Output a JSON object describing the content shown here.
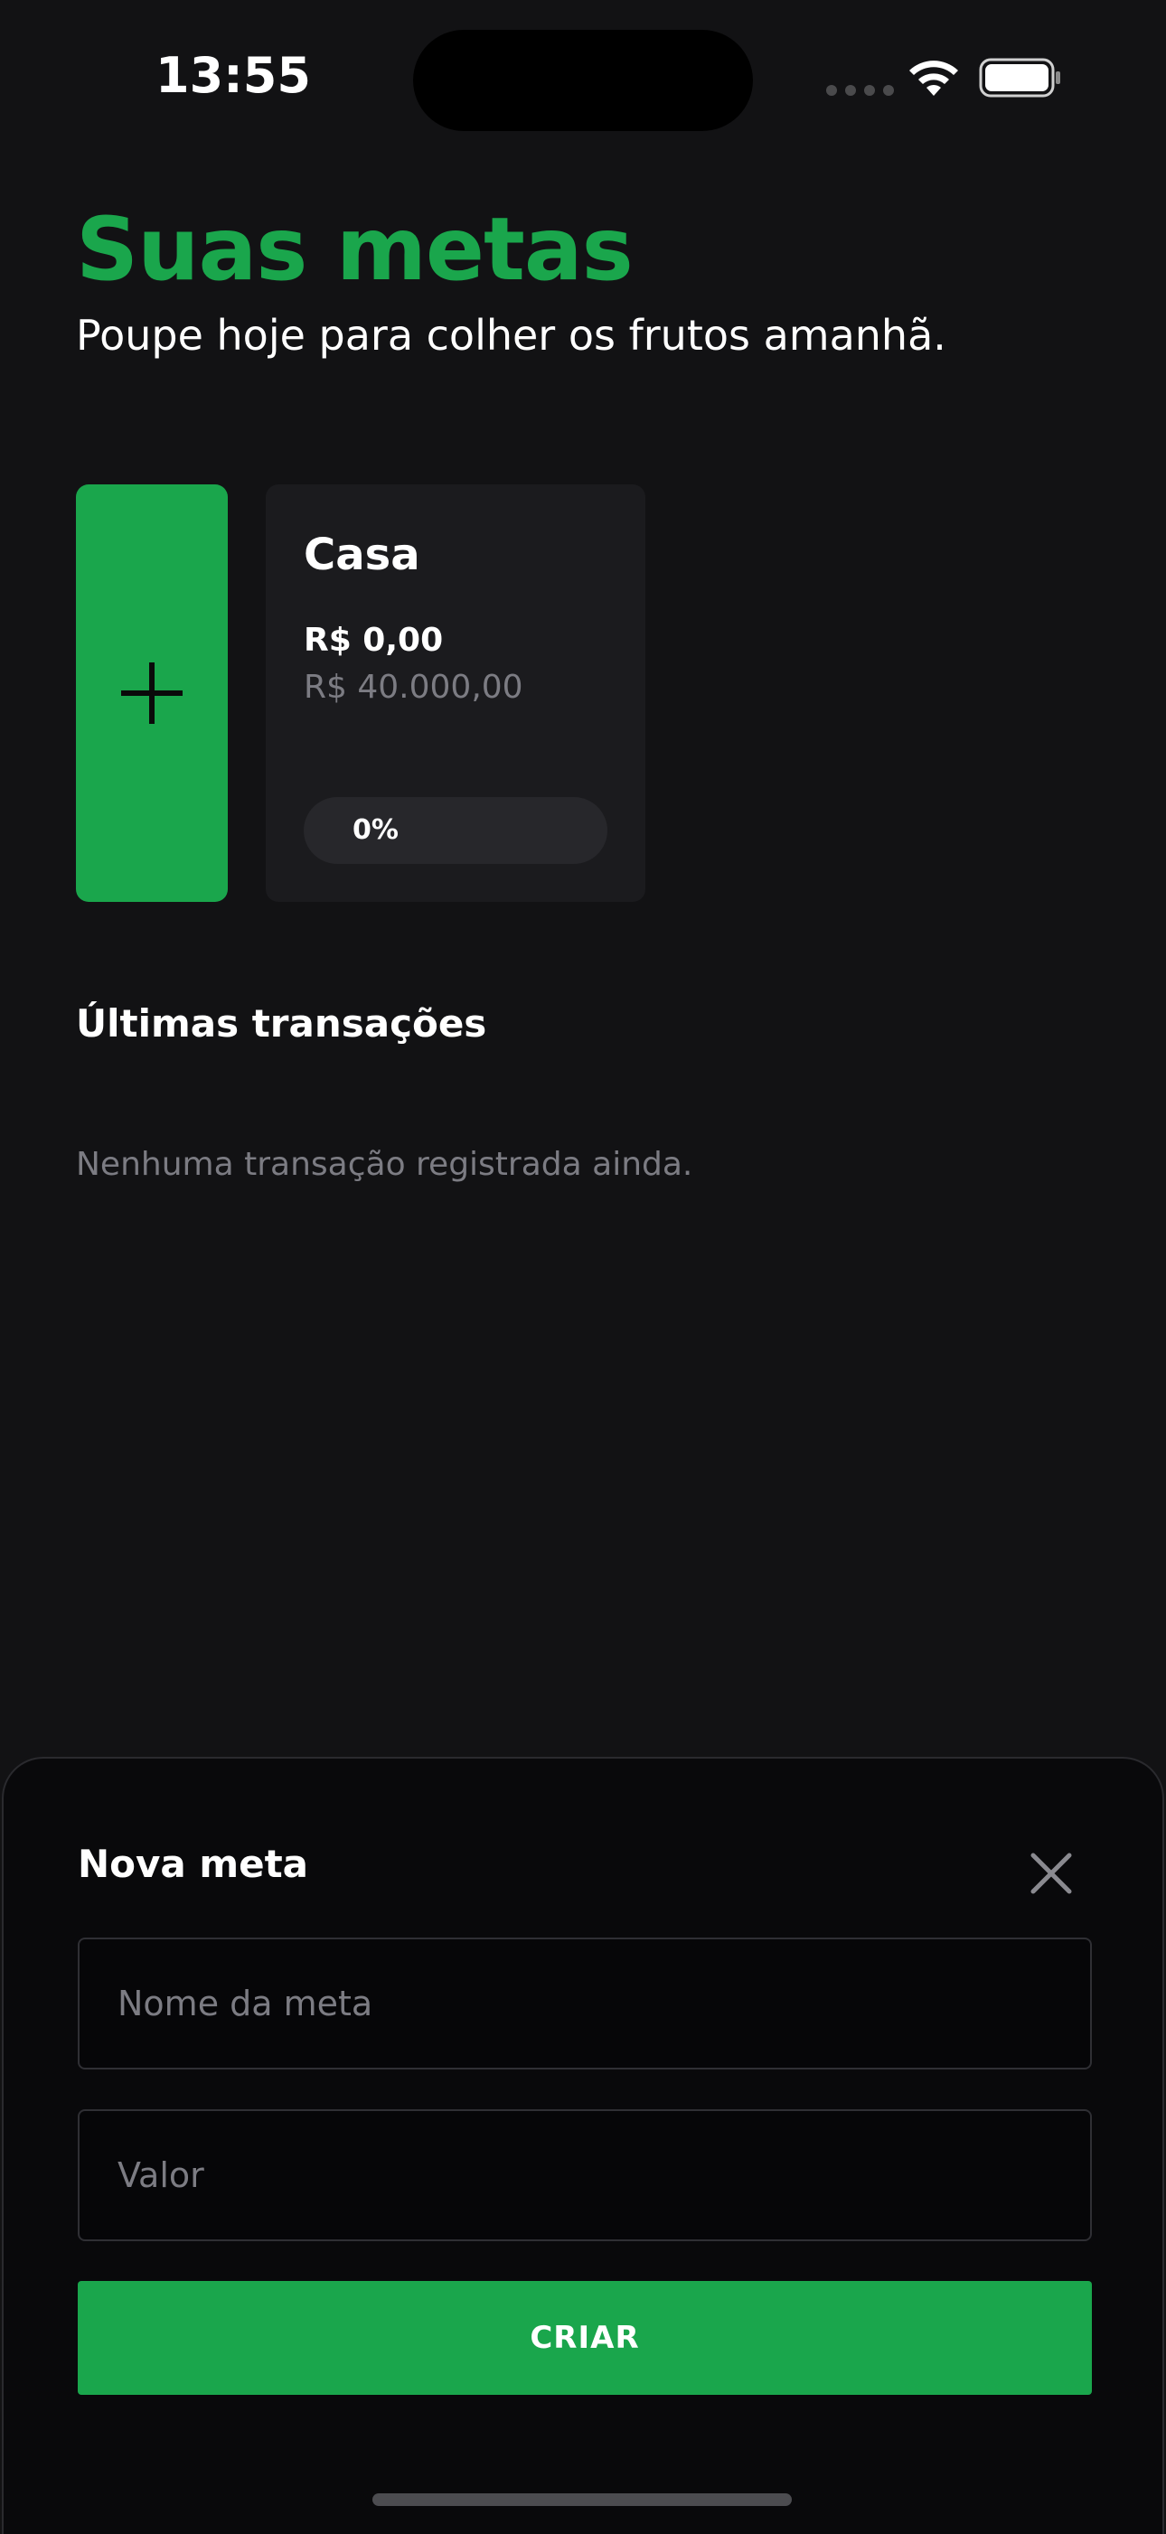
{
  "status_bar": {
    "time": "13:55"
  },
  "header": {
    "title": "Suas metas",
    "subtitle": "Poupe hoje para colher os frutos amanhã."
  },
  "goals": [
    {
      "name": "Casa",
      "current": "R$ 0,00",
      "target": "R$ 40.000,00",
      "progress_label": "0%",
      "progress_value": 0
    }
  ],
  "transactions": {
    "title": "Últimas transações",
    "empty_message": "Nenhuma transação registrada ainda."
  },
  "new_goal_sheet": {
    "title": "Nova meta",
    "name_placeholder": "Nome da meta",
    "value_placeholder": "Valor",
    "create_label": "CRIAR"
  },
  "colors": {
    "accent": "#1aa64c",
    "background": "#121214",
    "card": "#1b1b1e",
    "muted_text": "#7c7c83"
  },
  "icons": {
    "add_goal": "plus-icon",
    "close": "close-icon",
    "wifi": "wifi-icon",
    "battery": "battery-icon"
  }
}
